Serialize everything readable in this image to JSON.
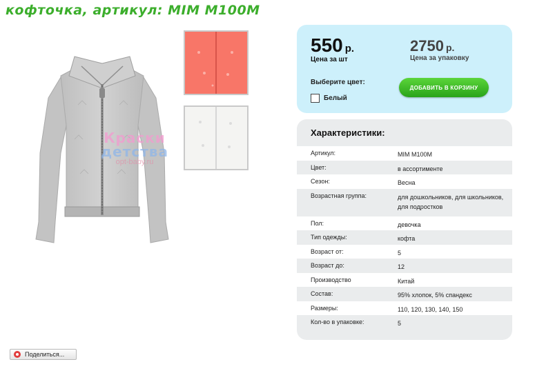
{
  "page": {
    "title": "кофточка, артикул: MIM M100M"
  },
  "watermark": {
    "line1": "Краски",
    "line2": "детства",
    "line3": "opt-baby.ru"
  },
  "thumbnails": [
    {
      "color_hex": "#f87668",
      "name": "coral"
    },
    {
      "color_hex": "#f4f4f2",
      "name": "white"
    }
  ],
  "pricing": {
    "unit_price": "550",
    "unit_currency": "р.",
    "unit_caption": "Цена за шт",
    "pack_price": "2750",
    "pack_currency": "р.",
    "pack_caption": "Цена за упаковку",
    "choose_color_label": "Выберите цвет:",
    "color_option": "Белый",
    "add_to_cart": "ДОБАВИТЬ В КОРЗИНУ"
  },
  "characteristics": {
    "header": "Характеристики:",
    "rows": [
      {
        "key": "Артикул:",
        "value": "MIM M100M"
      },
      {
        "key": "Цвет:",
        "value": "в ассортименте"
      },
      {
        "key": "Сезон:",
        "value": "Весна"
      },
      {
        "key": "Возрастная группа:",
        "value": "для дошкольников, для школьников, для подростков"
      },
      {
        "key": "Пол:",
        "value": "девочка"
      },
      {
        "key": "Тип одежды:",
        "value": "кофта"
      },
      {
        "key": "Возраст от:",
        "value": "5"
      },
      {
        "key": "Возраст до:",
        "value": "12"
      },
      {
        "key": "Производство",
        "value": "Китай"
      },
      {
        "key": "Состав:",
        "value": "95% хлопок, 5% спандекс"
      },
      {
        "key": "Размеры:",
        "value": "110, 120, 130, 140, 150"
      },
      {
        "key": "Кол-во в упаковке:",
        "value": "5"
      }
    ]
  },
  "share": {
    "label": "Поделиться..."
  },
  "colors": {
    "title_green": "#3cae2c",
    "price_box_bg": "#cdf0fb",
    "chars_box_bg": "#eaeced",
    "cart_button": "#3fbf26"
  }
}
